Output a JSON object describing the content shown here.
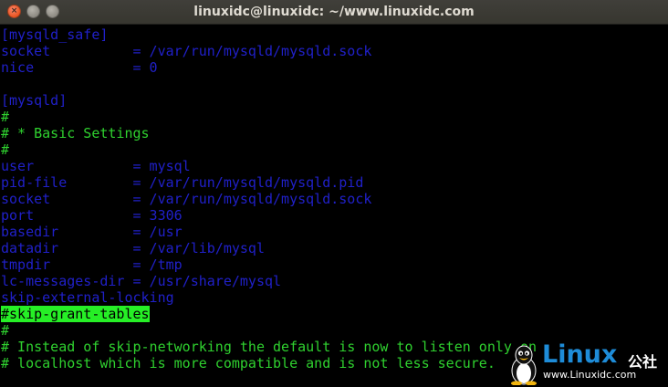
{
  "window": {
    "title": "linuxidc@linuxidc: ~/www.linuxidc.com"
  },
  "colors": {
    "config_text": "#2020c8",
    "comment_text": "#2fd12f",
    "highlight_bg": "#26ef26",
    "title_bar": "#3a3933",
    "close_button": "#e95420"
  },
  "icons": {
    "close": "close-icon",
    "minimize": "minimize-icon",
    "maximize": "maximize-icon",
    "watermark": "tux-penguin-logo"
  },
  "terminal": {
    "lines": [
      {
        "text": "[mysqld_safe]",
        "style": "blue"
      },
      {
        "text": "socket          = /var/run/mysqld/mysqld.sock",
        "style": "blue"
      },
      {
        "text": "nice            = 0",
        "style": "blue"
      },
      {
        "text": "",
        "style": "blue"
      },
      {
        "text": "[mysqld]",
        "style": "blue"
      },
      {
        "text": "#",
        "style": "green"
      },
      {
        "text": "# * Basic Settings",
        "style": "green"
      },
      {
        "text": "#",
        "style": "green"
      },
      {
        "text": "user            = mysql",
        "style": "blue"
      },
      {
        "text": "pid-file        = /var/run/mysqld/mysqld.pid",
        "style": "blue"
      },
      {
        "text": "socket          = /var/run/mysqld/mysqld.sock",
        "style": "blue"
      },
      {
        "text": "port            = 3306",
        "style": "blue"
      },
      {
        "text": "basedir         = /usr",
        "style": "blue"
      },
      {
        "text": "datadir         = /var/lib/mysql",
        "style": "blue"
      },
      {
        "text": "tmpdir          = /tmp",
        "style": "blue"
      },
      {
        "text": "lc-messages-dir = /usr/share/mysql",
        "style": "blue"
      },
      {
        "text": "skip-external-locking",
        "style": "blue"
      },
      {
        "text": "#skip-grant-tables",
        "style": "hl"
      },
      {
        "text": "#",
        "style": "green"
      },
      {
        "text": "# Instead of skip-networking the default is now to listen only on",
        "style": "green"
      },
      {
        "text": "# localhost which is more compatible and is not less secure.",
        "style": "green"
      }
    ]
  },
  "watermark": {
    "brand": "Linux",
    "brand_cn": "公社",
    "url": "www.Linuxidc.com"
  }
}
